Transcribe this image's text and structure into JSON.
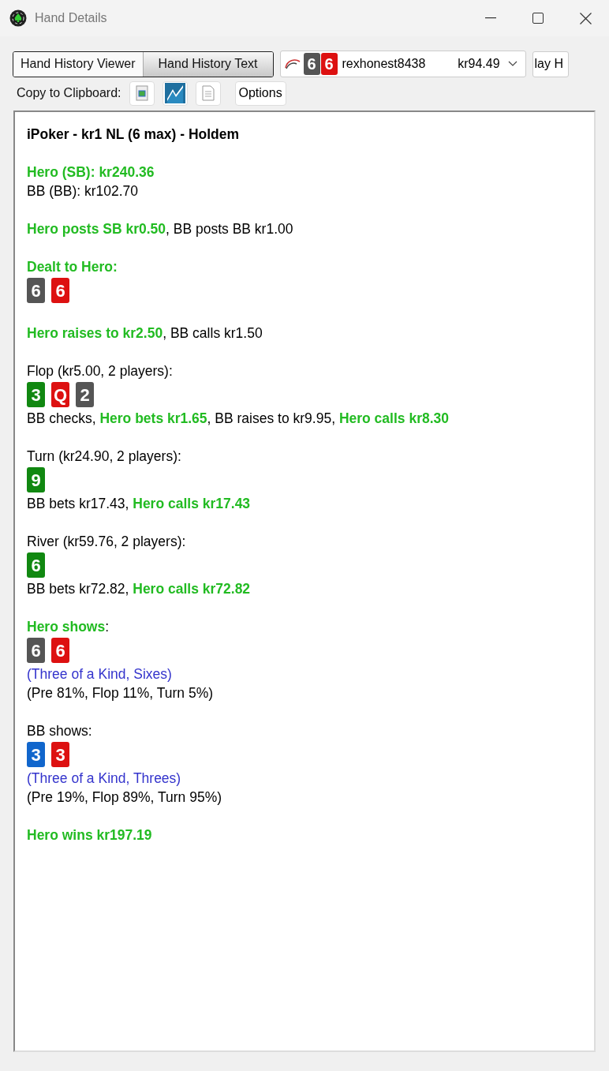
{
  "window": {
    "title": "Hand Details"
  },
  "tabs": [
    {
      "label": "Hand History Viewer",
      "selected": false
    },
    {
      "label": "Hand History Text",
      "selected": true
    }
  ],
  "hand_selector": {
    "cards": [
      {
        "rank": "6",
        "color": "#555555"
      },
      {
        "rank": "6",
        "color": "#dd1111"
      }
    ],
    "player": "rexhonest8438",
    "amount": "kr94.49"
  },
  "replay_button": "lay H",
  "toolbar": {
    "label": "Copy to Clipboard:",
    "options_button": "Options"
  },
  "history": {
    "title": "iPoker - kr1 NL (6 max) - Holdem",
    "blocks": [
      [
        {
          "kind": "text",
          "segments": [
            {
              "text": "Hero (SB): kr240.36",
              "hero": true
            }
          ]
        },
        {
          "kind": "text",
          "segments": [
            {
              "text": "BB (BB): kr102.70",
              "hero": false
            }
          ]
        }
      ],
      [
        {
          "kind": "text",
          "segments": [
            {
              "text": "Hero posts SB kr0.50",
              "hero": true
            },
            {
              "text": ", BB posts BB kr1.00",
              "hero": false
            }
          ]
        }
      ],
      [
        {
          "kind": "text",
          "segments": [
            {
              "text": "Dealt to Hero:",
              "hero": true
            }
          ]
        },
        {
          "kind": "cards",
          "cards": [
            {
              "rank": "6",
              "color": "#555555"
            },
            {
              "rank": "6",
              "color": "#dd1111"
            }
          ]
        }
      ],
      [
        {
          "kind": "text",
          "segments": [
            {
              "text": "Hero raises to kr2.50",
              "hero": true
            },
            {
              "text": ", BB calls kr1.50",
              "hero": false
            }
          ]
        }
      ],
      [
        {
          "kind": "text",
          "segments": [
            {
              "text": "Flop (kr5.00, 2 players):",
              "hero": false
            }
          ]
        },
        {
          "kind": "cards",
          "cards": [
            {
              "rank": "3",
              "color": "#118811"
            },
            {
              "rank": "Q",
              "color": "#dd1111"
            },
            {
              "rank": "2",
              "color": "#555555"
            }
          ]
        },
        {
          "kind": "text",
          "segments": [
            {
              "text": "BB checks, ",
              "hero": false
            },
            {
              "text": "Hero bets kr1.65",
              "hero": true
            },
            {
              "text": ", BB raises to kr9.95, ",
              "hero": false
            },
            {
              "text": "Hero calls kr8.30",
              "hero": true
            }
          ]
        }
      ],
      [
        {
          "kind": "text",
          "segments": [
            {
              "text": "Turn (kr24.90, 2 players):",
              "hero": false
            }
          ]
        },
        {
          "kind": "cards",
          "cards": [
            {
              "rank": "9",
              "color": "#118811"
            }
          ]
        },
        {
          "kind": "text",
          "segments": [
            {
              "text": "BB bets kr17.43, ",
              "hero": false
            },
            {
              "text": "Hero calls kr17.43",
              "hero": true
            }
          ]
        }
      ],
      [
        {
          "kind": "text",
          "segments": [
            {
              "text": "River (kr59.76, 2 players):",
              "hero": false
            }
          ]
        },
        {
          "kind": "cards",
          "cards": [
            {
              "rank": "6",
              "color": "#118811"
            }
          ]
        },
        {
          "kind": "text",
          "segments": [
            {
              "text": "BB bets kr72.82, ",
              "hero": false
            },
            {
              "text": "Hero calls kr72.82",
              "hero": true
            }
          ]
        }
      ],
      [
        {
          "kind": "text",
          "segments": [
            {
              "text": "Hero shows",
              "hero": true
            },
            {
              "text": ":",
              "hero": false
            }
          ]
        },
        {
          "kind": "cards",
          "cards": [
            {
              "rank": "6",
              "color": "#555555"
            },
            {
              "rank": "6",
              "color": "#dd1111"
            }
          ]
        },
        {
          "kind": "hand",
          "text": "(Three of a Kind, Sixes)"
        },
        {
          "kind": "text",
          "segments": [
            {
              "text": "(Pre 81%, Flop 11%, Turn 5%)",
              "hero": false
            }
          ]
        }
      ],
      [
        {
          "kind": "text",
          "segments": [
            {
              "text": "BB shows:",
              "hero": false
            }
          ]
        },
        {
          "kind": "cards",
          "cards": [
            {
              "rank": "3",
              "color": "#1166cc"
            },
            {
              "rank": "3",
              "color": "#dd1111"
            }
          ]
        },
        {
          "kind": "hand",
          "text": "(Three of a Kind, Threes)"
        },
        {
          "kind": "text",
          "segments": [
            {
              "text": "(Pre 19%, Flop 89%, Turn 95%)",
              "hero": false
            }
          ]
        }
      ],
      [
        {
          "kind": "text",
          "segments": [
            {
              "text": "Hero wins kr197.19",
              "hero": true
            }
          ]
        }
      ]
    ]
  }
}
